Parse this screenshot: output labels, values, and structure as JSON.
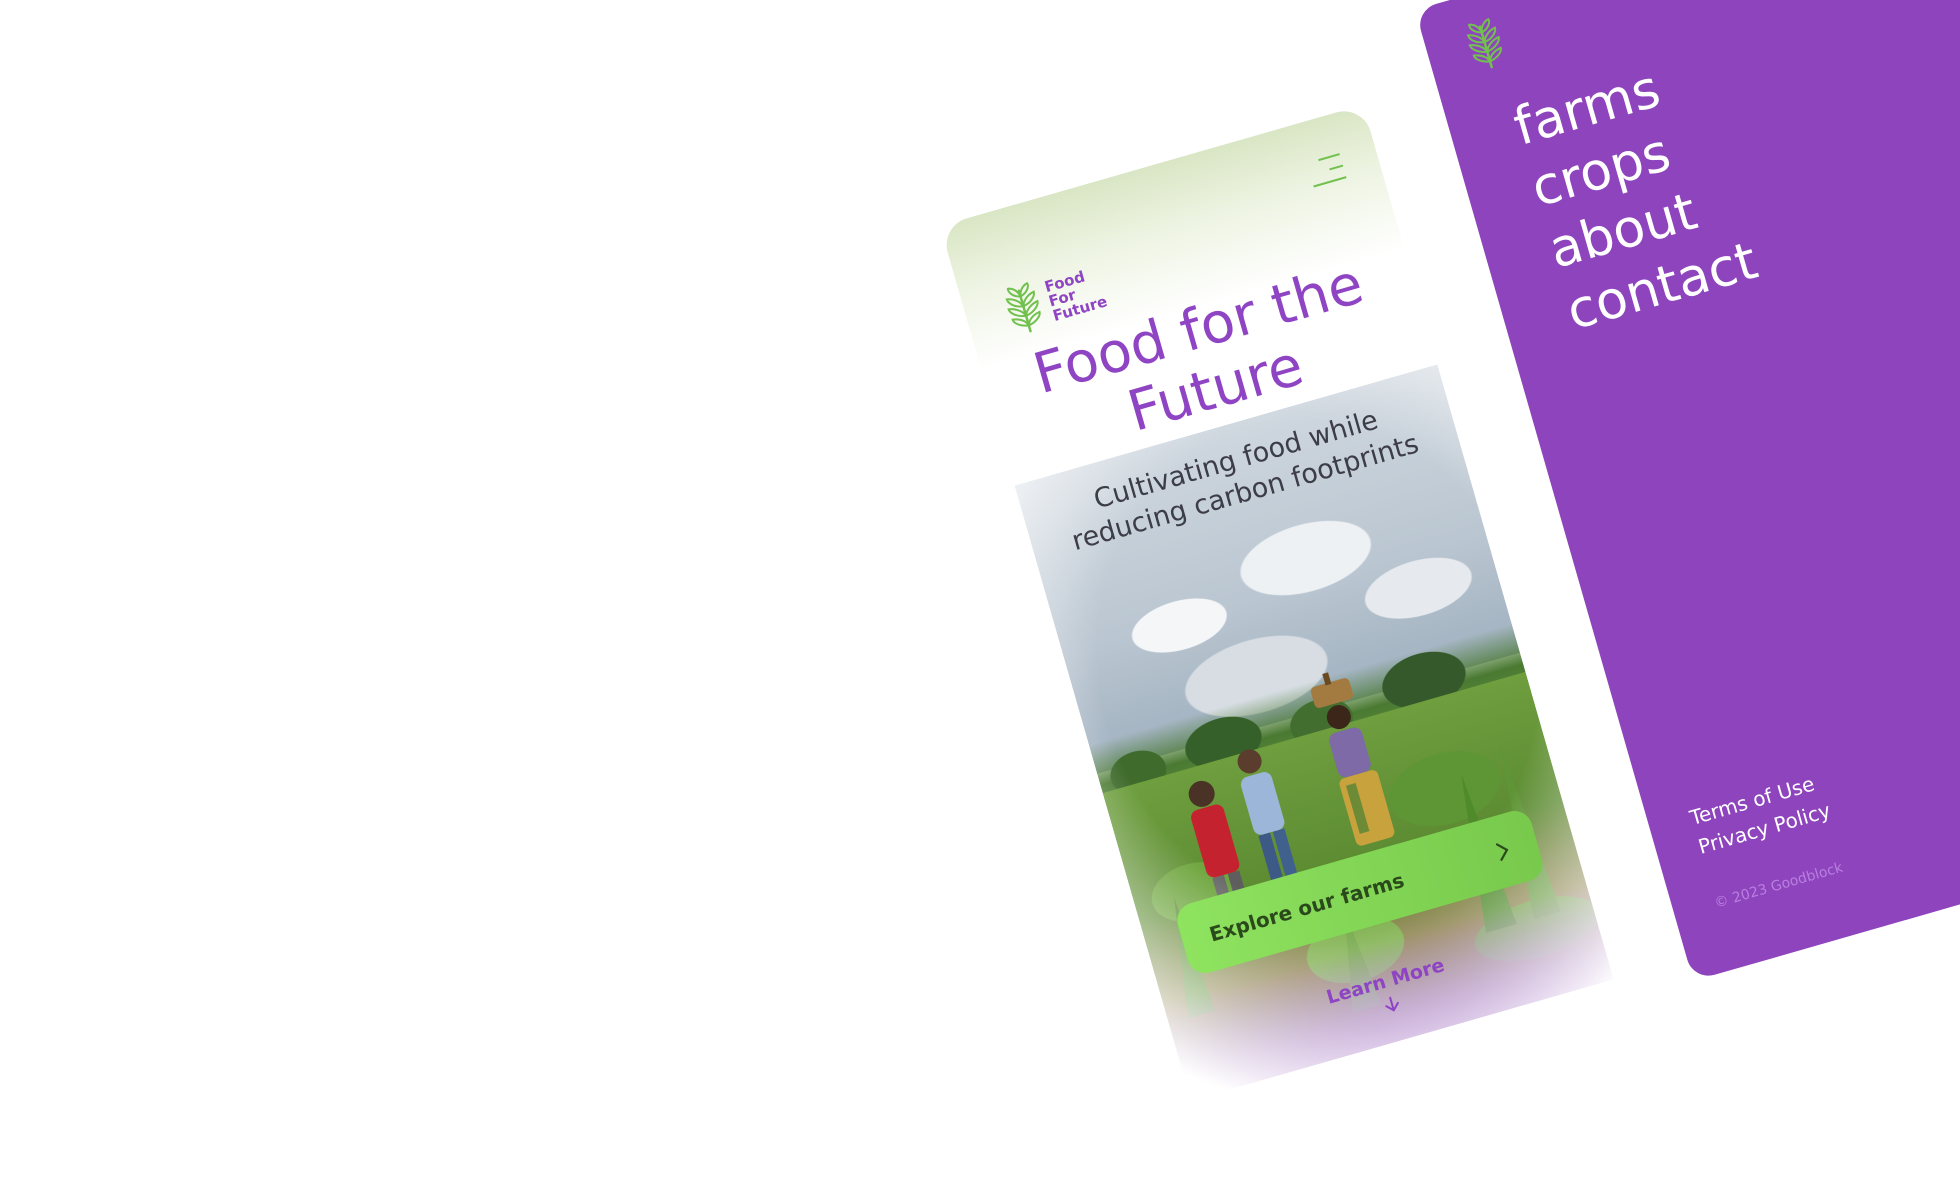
{
  "brand": {
    "name": "Food For Future",
    "accent": "#8e44c3",
    "green": "#72c14f",
    "icon": "wheat-icon"
  },
  "home": {
    "menu_icon": "hamburger-menu-icon",
    "hero_title": "Food for the Future",
    "hero_subtitle": "Cultivating food while reducing carbon footprints",
    "cta_label": "Explore our farms",
    "cta_icon": "chevron-right-icon",
    "learn_more_label": "Learn More",
    "learn_more_icon": "arrow-down-icon"
  },
  "menu": {
    "background": "#8e44bd",
    "items": [
      {
        "label": "farms"
      },
      {
        "label": "crops"
      },
      {
        "label": "about"
      },
      {
        "label": "contact"
      }
    ],
    "footer": {
      "terms": "Terms of Use",
      "privacy": "Privacy Policy",
      "copyright": "© 2023 Goodblock"
    }
  }
}
